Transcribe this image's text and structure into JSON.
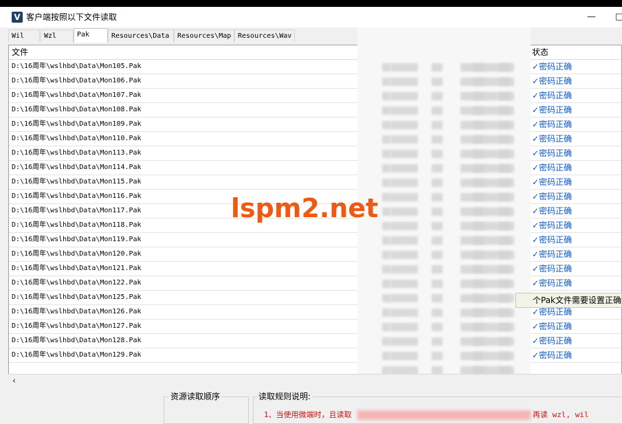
{
  "window": {
    "title": "客户端按照以下文件读取",
    "logo_letter": "V"
  },
  "tabs": [
    "Wil",
    "Wzl",
    "Pak",
    "Resources\\Data",
    "Resources\\Map",
    "Resources\\Wav"
  ],
  "active_tab": "Pak",
  "table": {
    "columns": {
      "file": "文件",
      "status": "状态"
    },
    "rows": [
      {
        "file": "D:\\16周年\\wslhbd\\Data\\Mon105.Pak",
        "status": "密码正确"
      },
      {
        "file": "D:\\16周年\\wslhbd\\Data\\Mon106.Pak",
        "status": "密码正确"
      },
      {
        "file": "D:\\16周年\\wslhbd\\Data\\Mon107.Pak",
        "status": "密码正确"
      },
      {
        "file": "D:\\16周年\\wslhbd\\Data\\Mon108.Pak",
        "status": "密码正确"
      },
      {
        "file": "D:\\16周年\\wslhbd\\Data\\Mon109.Pak",
        "status": "密码正确"
      },
      {
        "file": "D:\\16周年\\wslhbd\\Data\\Mon110.Pak",
        "status": "密码正确"
      },
      {
        "file": "D:\\16周年\\wslhbd\\Data\\Mon113.Pak",
        "status": "密码正确"
      },
      {
        "file": "D:\\16周年\\wslhbd\\Data\\Mon114.Pak",
        "status": "密码正确"
      },
      {
        "file": "D:\\16周年\\wslhbd\\Data\\Mon115.Pak",
        "status": "密码正确"
      },
      {
        "file": "D:\\16周年\\wslhbd\\Data\\Mon116.Pak",
        "status": "密码正确"
      },
      {
        "file": "D:\\16周年\\wslhbd\\Data\\Mon117.Pak",
        "status": "密码正确"
      },
      {
        "file": "D:\\16周年\\wslhbd\\Data\\Mon118.Pak",
        "status": "密码正确"
      },
      {
        "file": "D:\\16周年\\wslhbd\\Data\\Mon119.Pak",
        "status": "密码正确"
      },
      {
        "file": "D:\\16周年\\wslhbd\\Data\\Mon120.Pak",
        "status": "密码正确"
      },
      {
        "file": "D:\\16周年\\wslhbd\\Data\\Mon121.Pak",
        "status": "密码正确"
      },
      {
        "file": "D:\\16周年\\wslhbd\\Data\\Mon122.Pak",
        "status": "密码正确"
      },
      {
        "file": "D:\\16周年\\wslhbd\\Data\\Mon125.Pak",
        "status": ""
      },
      {
        "file": "D:\\16周年\\wslhbd\\Data\\Mon126.Pak",
        "status": "密码正确"
      },
      {
        "file": "D:\\16周年\\wslhbd\\Data\\Mon127.Pak",
        "status": "密码正确"
      },
      {
        "file": "D:\\16周年\\wslhbd\\Data\\Mon128.Pak",
        "status": "密码正确"
      },
      {
        "file": "D:\\16周年\\wslhbd\\Data\\Mon129.Pak",
        "status": "密码正确"
      }
    ]
  },
  "check_symbol": "✓",
  "tooltip": "个Pak文件需要设置正确",
  "watermark": "lspm2.net",
  "hscroll_left": "‹",
  "bottom": {
    "load_order_label": "资源读取顺序",
    "rules_label": "读取规则说明:",
    "rule_line_start": "1、当使用微端时，且读取",
    "rule_line_end": "再读 wzl, wil"
  },
  "win_controls": {
    "minimize": "—",
    "close": "□"
  }
}
